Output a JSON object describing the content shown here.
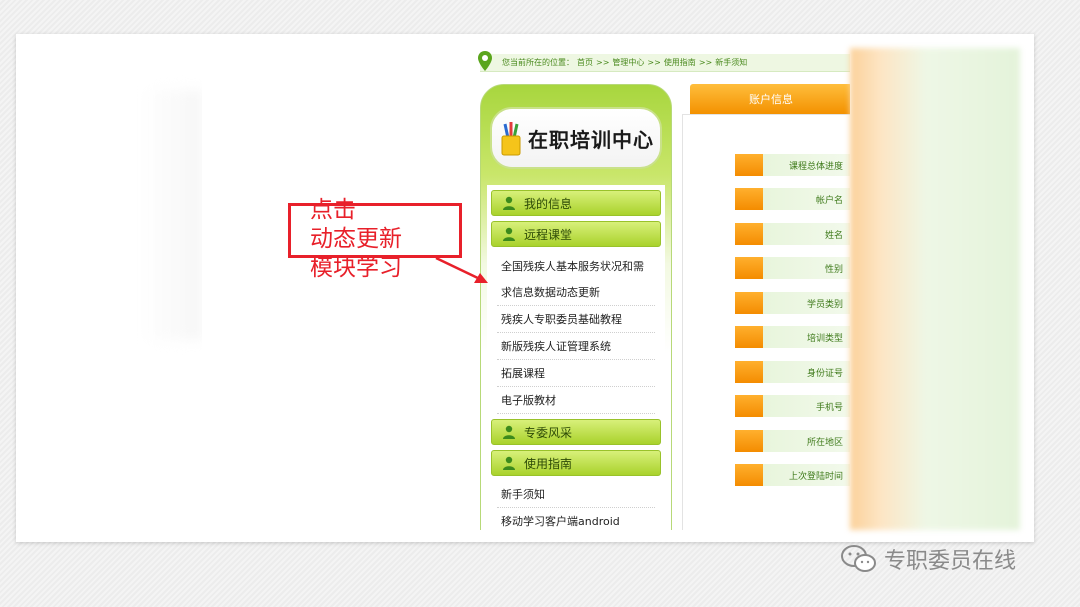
{
  "breadcrumb": {
    "prefix": "您当前所在的位置：",
    "items": [
      "首页",
      ">>",
      "管理中心",
      ">>",
      "使用指南",
      ">>",
      "新手须知"
    ]
  },
  "logo": {
    "title": "在职培训中心"
  },
  "menu": {
    "sections": [
      {
        "label": "我的信息",
        "items": []
      },
      {
        "label": "远程课堂",
        "items": [
          "全国残疾人基本服务状况和需",
          "求信息数据动态更新",
          "残疾人专职委员基础教程",
          "新版残疾人证管理系统",
          "拓展课程",
          "电子版教材"
        ]
      },
      {
        "label": "专委风采",
        "items": []
      },
      {
        "label": "使用指南",
        "items": [
          "新手须知",
          "移动学习客户端android"
        ]
      }
    ]
  },
  "account": {
    "tab_label": "账户信息",
    "fields": [
      "课程总体进度",
      "帐户名",
      "姓名",
      "性别",
      "学员类别",
      "培训类型",
      "身份证号",
      "手机号",
      "所在地区",
      "上次登陆时间"
    ]
  },
  "annotation": {
    "lines": [
      "点击",
      "动态更新",
      "模块学习"
    ]
  },
  "watermark": {
    "text": "专职委员在线"
  },
  "colors": {
    "accent_green": "#a9d22c",
    "accent_orange": "#f39100",
    "annotation_red": "#e8202a"
  }
}
